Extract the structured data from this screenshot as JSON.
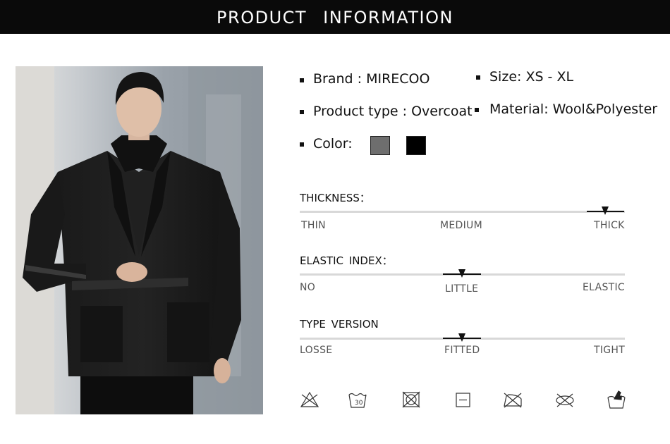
{
  "header": {
    "title": "PRODUCT  INFORMATION"
  },
  "specs": {
    "brand": "Brand : MIRECOO",
    "size": "Size: XS - XL",
    "product_type": "Product type : Overcoat",
    "material": "Material: Wool&Polyester",
    "color": "Color:",
    "color_swatches": [
      "#6e6e6e",
      "#000000"
    ]
  },
  "scales": [
    {
      "title": "THICKNESS：",
      "labels": [
        "THIN",
        "MEDIUM",
        "THICK"
      ],
      "selected": "THICK"
    },
    {
      "title": "ELASTIC  INDEX：",
      "labels": [
        "NO",
        "LITTLE",
        "ELASTIC"
      ],
      "selected": "LITTLE"
    },
    {
      "title": "TYPE  VERSION",
      "labels": [
        "LOSSE",
        "FITTED",
        "TIGHT"
      ],
      "selected": "FITTED"
    }
  ],
  "care_icons": [
    "do-not-bleach-icon",
    "hand-wash-icon",
    "do-not-tumble-dry-icon",
    "dry-flat-icon",
    "do-not-iron-icon",
    "do-not-dry-clean-icon",
    "hand-wash-only-icon"
  ]
}
